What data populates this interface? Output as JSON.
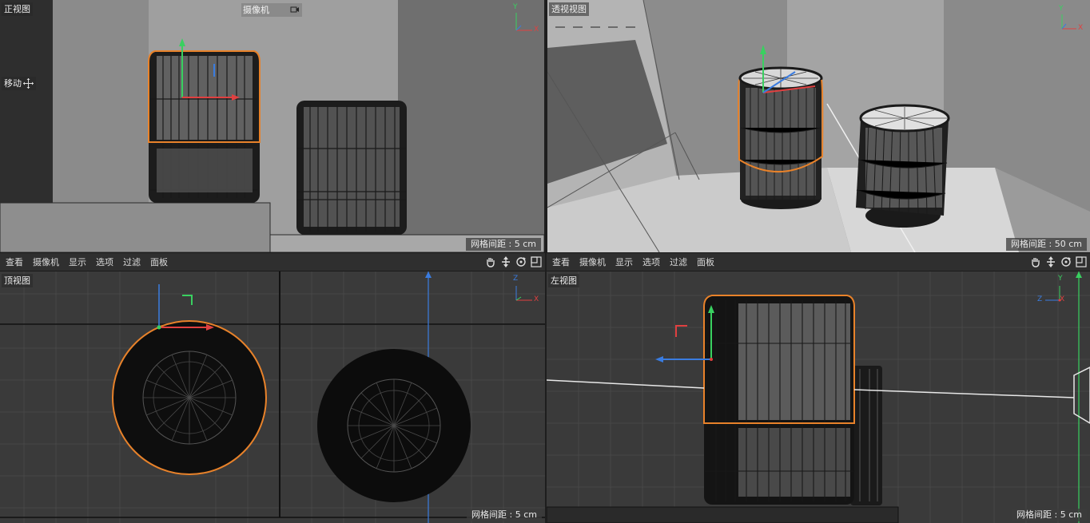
{
  "viewports": {
    "front": {
      "label": "正视图",
      "grid": "网格间距 : 5 cm",
      "camera_dropdown": "摄像机",
      "tool_label": "移动",
      "axis": {
        "v": "Y",
        "h": "X"
      }
    },
    "perspective": {
      "label": "透视视图",
      "grid": "网格间距 : 50 cm",
      "axis": {
        "v": "Y",
        "h": "X"
      }
    },
    "top": {
      "label": "顶视图",
      "grid": "网格间距 : 5 cm",
      "axis": {
        "v": "Z",
        "h": "X"
      }
    },
    "left": {
      "label": "左视图",
      "grid": "网格间距 : 5 cm",
      "axis": {
        "v": "Y",
        "h": "Z",
        "extra": "X"
      }
    }
  },
  "menu": {
    "view": "查看",
    "cameras": "摄像机",
    "display": "显示",
    "options": "选项",
    "filter": "过滤",
    "panel": "面板"
  },
  "colors": {
    "selection": "#e8822a",
    "axis_x": "#e04040",
    "axis_y": "#39d060",
    "axis_z": "#3a7ce0"
  }
}
